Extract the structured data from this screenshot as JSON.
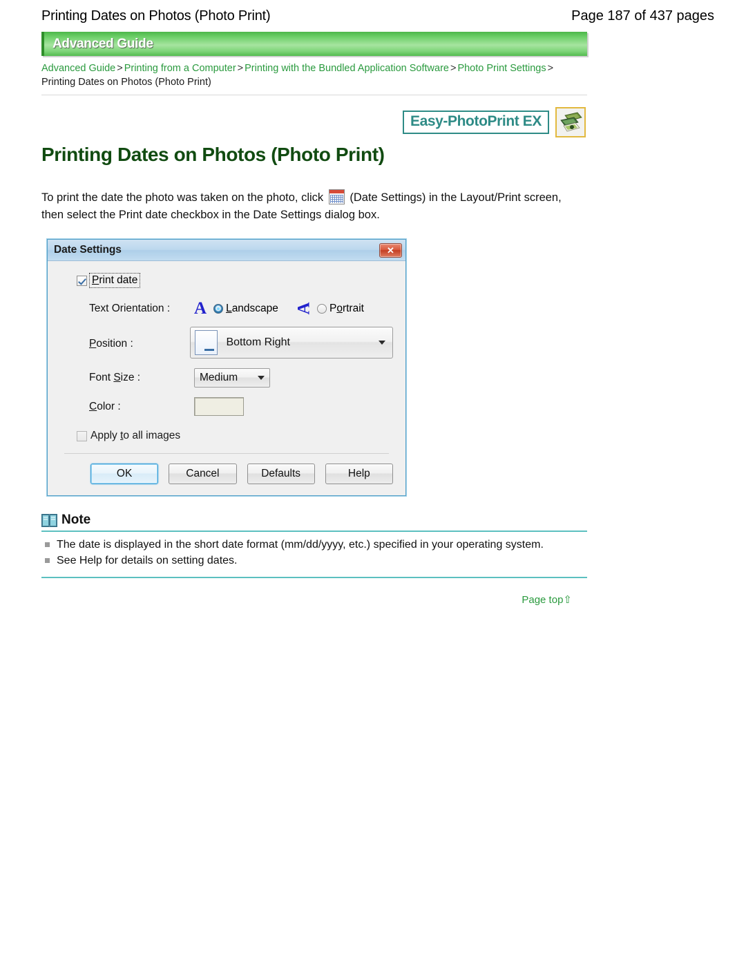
{
  "page_header": {
    "title": "Printing Dates on Photos (Photo Print)",
    "page_count": "Page 187 of 437 pages"
  },
  "banner": {
    "label": "Advanced Guide"
  },
  "breadcrumb": {
    "items": [
      {
        "label": "Advanced Guide",
        "link": true
      },
      {
        "label": "Printing from a Computer",
        "link": true
      },
      {
        "label": "Printing with the Bundled Application Software",
        "link": true
      },
      {
        "label": "Photo Print Settings",
        "link": true
      }
    ],
    "separator": ">",
    "current": "Printing Dates on Photos (Photo Print)"
  },
  "logo": {
    "badge_text": "Easy-PhotoPrint EX",
    "icon_name": "easy-photoprint-ex-icon",
    "badge_color": "#2e8b86",
    "icon_border_color": "#e2b93f"
  },
  "page_title": "Printing Dates on Photos (Photo Print)",
  "body": {
    "line1_before_icon": "To print the date the photo was taken on the photo, click",
    "icon_name": "date-settings-calendar-icon",
    "line1_after_icon": "(Date Settings) in the Layout/Print screen,",
    "line2": "then select the Print date checkbox in the Date Settings dialog box."
  },
  "dialog": {
    "title": "Date Settings",
    "close_label": "✕",
    "print_date": {
      "label": "Print date",
      "checked": true
    },
    "text_orientation": {
      "label": "Text Orientation :",
      "landscape_label": "Landscape",
      "portrait_label": "Portrait",
      "landscape_glyph": "A",
      "portrait_glyph": "A",
      "selected": "Landscape"
    },
    "position": {
      "label": "Position :",
      "value": "Bottom Right"
    },
    "font_size": {
      "label": "Font Size :",
      "value": "Medium"
    },
    "color": {
      "label": "Color :",
      "value": "#c22408"
    },
    "apply_all": {
      "label": "Apply to all images",
      "checked": false
    },
    "buttons": [
      {
        "label": "OK",
        "default": true
      },
      {
        "label": "Cancel",
        "default": false
      },
      {
        "label": "Defaults",
        "default": false
      },
      {
        "label": "Help",
        "default": false
      }
    ]
  },
  "note": {
    "title": "Note",
    "icon_name": "open-book-icon",
    "items": [
      "The date is displayed in the short date format (mm/dd/yyyy, etc.) specified in your operating system.",
      "See Help for details on setting dates."
    ]
  },
  "page_top": {
    "label": "Page top",
    "arrow": "⇧"
  }
}
